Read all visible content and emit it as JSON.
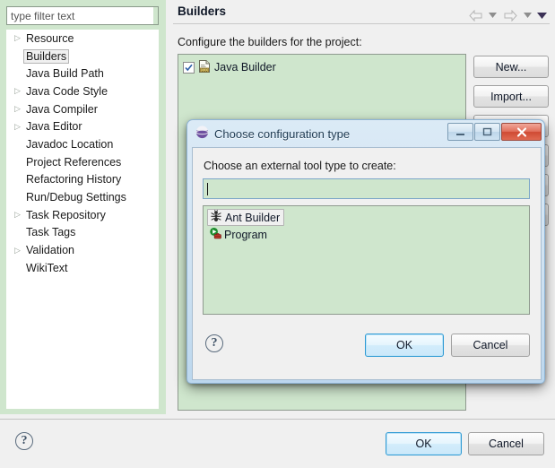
{
  "window": {
    "title": "Builders"
  },
  "filter": {
    "placeholder": "type filter text",
    "value": ""
  },
  "tree": {
    "items": [
      {
        "label": "Resource",
        "expandable": true,
        "selected": false
      },
      {
        "label": "Builders",
        "expandable": false,
        "selected": true
      },
      {
        "label": "Java Build Path",
        "expandable": false,
        "selected": false
      },
      {
        "label": "Java Code Style",
        "expandable": true,
        "selected": false
      },
      {
        "label": "Java Compiler",
        "expandable": true,
        "selected": false
      },
      {
        "label": "Java Editor",
        "expandable": true,
        "selected": false
      },
      {
        "label": "Javadoc Location",
        "expandable": false,
        "selected": false
      },
      {
        "label": "Project References",
        "expandable": false,
        "selected": false
      },
      {
        "label": "Refactoring History",
        "expandable": false,
        "selected": false
      },
      {
        "label": "Run/Debug Settings",
        "expandable": false,
        "selected": false
      },
      {
        "label": "Task Repository",
        "expandable": true,
        "selected": false
      },
      {
        "label": "Task Tags",
        "expandable": false,
        "selected": false
      },
      {
        "label": "Validation",
        "expandable": true,
        "selected": false
      },
      {
        "label": "WikiText",
        "expandable": false,
        "selected": false
      }
    ]
  },
  "header": {
    "title": "Builders",
    "nav": {
      "back_icon": "back-arrow-icon",
      "back_menu_icon": "chevron-down-icon",
      "forward_icon": "forward-arrow-icon",
      "forward_menu_icon": "chevron-down-icon",
      "view_menu_icon": "chevron-down-icon"
    }
  },
  "page": {
    "description": "Configure the builders for the project:",
    "builders": [
      {
        "label": "Java Builder",
        "checked": true,
        "icon": "java-builder-icon"
      }
    ],
    "side_buttons": [
      {
        "label": "New...",
        "enabled": true
      },
      {
        "label": "Import...",
        "enabled": true
      }
    ]
  },
  "footer": {
    "help_icon": "help-icon",
    "ok_label": "OK",
    "cancel_label": "Cancel"
  },
  "modal": {
    "title": "Choose configuration type",
    "app_icon": "eclipse-globe-icon",
    "window_buttons": {
      "minimize": "minimize-icon",
      "maximize": "maximize-icon",
      "close": "close-icon"
    },
    "prompt": "Choose an external tool type to create:",
    "input": {
      "value": "",
      "placeholder": ""
    },
    "types": [
      {
        "label": "Ant Builder",
        "icon": "ant-icon",
        "selected": true
      },
      {
        "label": "Program",
        "icon": "program-icon",
        "selected": false
      }
    ],
    "help_icon": "help-icon",
    "ok_label": "OK",
    "cancel_label": "Cancel"
  },
  "colors": {
    "panel_green": "#cfe6cd",
    "dialog_blue": "#cfe2f2",
    "close_red": "#cf4a33",
    "focus_blue": "#2e9ad4"
  }
}
